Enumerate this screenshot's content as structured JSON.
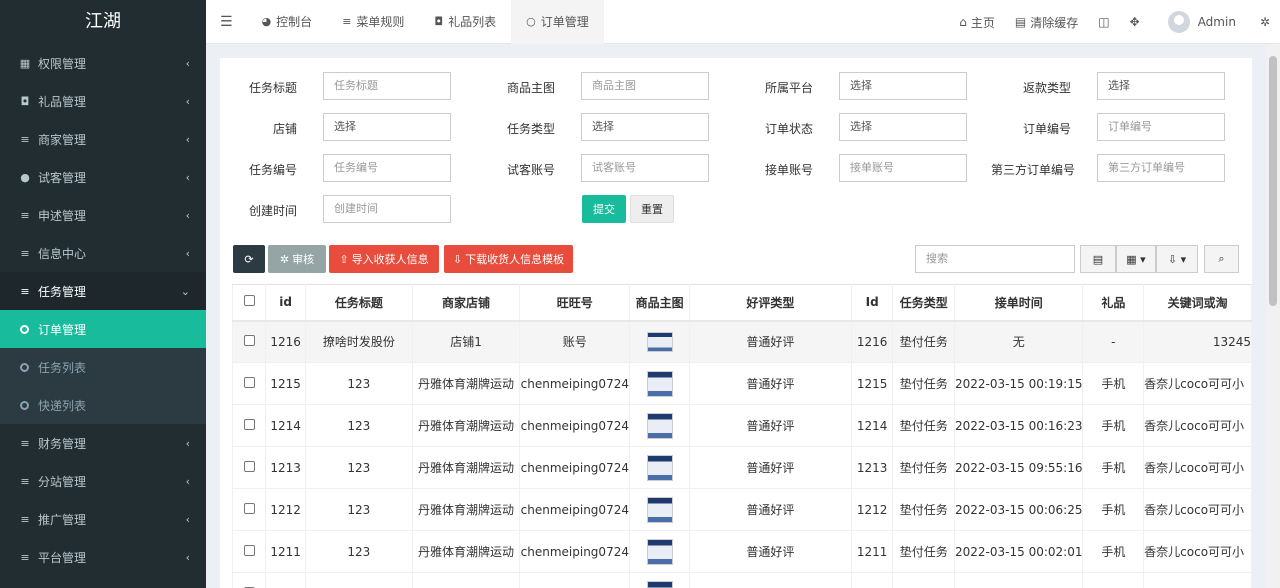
{
  "app": {
    "brand": "江湖"
  },
  "sidebar": {
    "items": [
      {
        "icon": "group-icon",
        "glyph": "▦",
        "label": "权限管理"
      },
      {
        "icon": "gift-icon",
        "glyph": "◘",
        "label": "礼品管理"
      },
      {
        "icon": "list-icon",
        "glyph": "≡",
        "label": "商家管理"
      },
      {
        "icon": "user-circle-icon",
        "glyph": "●",
        "label": "试客管理"
      },
      {
        "icon": "list-icon",
        "glyph": "≡",
        "label": "申述管理"
      },
      {
        "icon": "list-icon",
        "glyph": "≡",
        "label": "信息中心"
      },
      {
        "icon": "list-icon",
        "glyph": "≡",
        "label": "任务管理"
      }
    ],
    "subitems": [
      {
        "label": "订单管理",
        "active": true
      },
      {
        "label": "任务列表",
        "active": false
      },
      {
        "label": "快递列表",
        "active": false
      }
    ],
    "items_after": [
      {
        "icon": "list-icon",
        "glyph": "≡",
        "label": "财务管理"
      },
      {
        "icon": "list-icon",
        "glyph": "≡",
        "label": "分站管理"
      },
      {
        "icon": "list-icon",
        "glyph": "≡",
        "label": "推广管理"
      },
      {
        "icon": "list-icon",
        "glyph": "≡",
        "label": "平台管理"
      }
    ]
  },
  "topbar": {
    "menu_glyph": "☰",
    "tabs": [
      {
        "icon": "dashboard-icon",
        "glyph": "◕",
        "label": "控制台"
      },
      {
        "icon": "list-icon",
        "glyph": "≡",
        "label": "菜单规则"
      },
      {
        "icon": "gift-icon",
        "glyph": "◘",
        "label": "礼品列表"
      },
      {
        "icon": "circle-icon",
        "glyph": "○",
        "label": "订单管理"
      }
    ],
    "home_label": "主页",
    "clear_cache_label": "清除缓存",
    "user_name": "Admin"
  },
  "filters": {
    "row1": [
      {
        "label": "任务标题",
        "kind": "input",
        "placeholder": "任务标题"
      },
      {
        "label": "商品主图",
        "kind": "input",
        "placeholder": "商品主图"
      },
      {
        "label": "所属平台",
        "kind": "select",
        "value": "选择"
      },
      {
        "label": "返款类型",
        "kind": "select",
        "value": "选择"
      }
    ],
    "row2": [
      {
        "label": "店铺",
        "kind": "select",
        "value": "选择"
      },
      {
        "label": "任务类型",
        "kind": "select",
        "value": "选择"
      },
      {
        "label": "订单状态",
        "kind": "select",
        "value": "选择"
      },
      {
        "label": "订单编号",
        "kind": "input",
        "placeholder": "订单编号"
      }
    ],
    "row3": [
      {
        "label": "任务编号",
        "kind": "input",
        "placeholder": "任务编号"
      },
      {
        "label": "试客账号",
        "kind": "input",
        "placeholder": "试客账号"
      },
      {
        "label": "接单账号",
        "kind": "input",
        "placeholder": "接单账号"
      },
      {
        "label": "第三方订单编号",
        "kind": "input",
        "placeholder": "第三方订单编号"
      }
    ],
    "row4": [
      {
        "label": "创建时间",
        "kind": "input",
        "placeholder": "创建时间"
      }
    ],
    "submit_label": "提交",
    "reset_label": "重置"
  },
  "toolbar": {
    "refresh_glyph": "⟳",
    "audit_label": "审核",
    "import_label": "导入收获人信息",
    "download_label": "下载收货人信息模板",
    "search_placeholder": "搜索",
    "colors": {
      "dark": "#2c3b41",
      "gray": "#95a5a6",
      "red": "#e74c3c",
      "green": "#18bc9c"
    }
  },
  "table": {
    "columns": [
      "id",
      "任务标题",
      "商家店铺",
      "旺旺号",
      "商品主图",
      "好评类型",
      "Id",
      "任务类型",
      "接单时间",
      "礼品",
      "关键词或淘"
    ],
    "rows": [
      [
        "1216",
        "撩啥时发股份",
        "店铺1",
        "账号",
        "",
        "普通好评",
        "1216",
        "垫付任务",
        "无",
        "-",
        "13245"
      ],
      [
        "1215",
        "123",
        "丹雅体育潮牌运动",
        "chenmeiping0724",
        "",
        "普通好评",
        "1215",
        "垫付任务",
        "2022-03-15 00:19:15",
        "手机",
        "香奈儿coco可可小"
      ],
      [
        "1214",
        "123",
        "丹雅体育潮牌运动",
        "chenmeiping0724",
        "",
        "普通好评",
        "1214",
        "垫付任务",
        "2022-03-15 00:16:23",
        "手机",
        "香奈儿coco可可小"
      ],
      [
        "1213",
        "123",
        "丹雅体育潮牌运动",
        "chenmeiping0724",
        "",
        "普通好评",
        "1213",
        "垫付任务",
        "2022-03-15 09:55:16",
        "手机",
        "香奈儿coco可可小"
      ],
      [
        "1212",
        "123",
        "丹雅体育潮牌运动",
        "chenmeiping0724",
        "",
        "普通好评",
        "1212",
        "垫付任务",
        "2022-03-15 00:06:25",
        "手机",
        "香奈儿coco可可小"
      ],
      [
        "1211",
        "123",
        "丹雅体育潮牌运动",
        "chenmeiping0724",
        "",
        "普通好评",
        "1211",
        "垫付任务",
        "2022-03-15 00:02:01",
        "手机",
        "香奈儿coco可可小"
      ],
      [
        "",
        "",
        "",
        "",
        "",
        "",
        "",
        "",
        "",
        "",
        ""
      ]
    ]
  }
}
